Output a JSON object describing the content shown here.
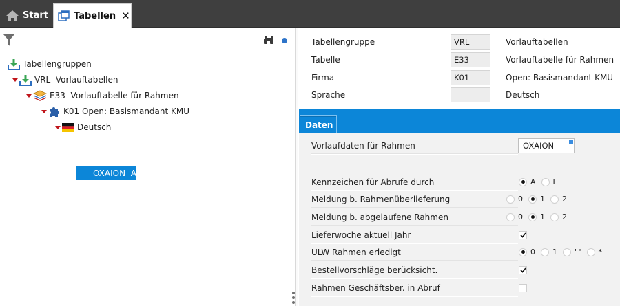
{
  "tabs": [
    {
      "label": "Start",
      "icon": "home-icon"
    },
    {
      "label": "Tabellen",
      "icon": "window-icon",
      "close": "✕"
    }
  ],
  "tree": {
    "toolbar": {
      "filter_icon": "filter-icon",
      "search_icon": "binoculars-icon",
      "status_icon": "status-dot-icon"
    },
    "nodes": [
      {
        "label": "Tabellengruppen",
        "icon": "download-icon"
      },
      {
        "label": "VRL  Vorlauftabellen",
        "icon": "download-icon"
      },
      {
        "label": "E33  Vorlauftabelle für Rahmen",
        "icon": "table-layers-icon"
      },
      {
        "label": "K01 Open: Basismandant KMU",
        "icon": "puzzle-icon"
      },
      {
        "label": "Deutsch",
        "icon": "german-flag-icon"
      }
    ],
    "selected": "OXAION  A"
  },
  "header_fields": [
    {
      "label": "Tabellengruppe",
      "code": "VRL",
      "desc": "Vorlauftabellen"
    },
    {
      "label": "Tabelle",
      "code": "E33",
      "desc": "Vorlauftabelle für Rahmen"
    },
    {
      "label": "Firma",
      "code": "K01",
      "desc": "Open: Basismandant KMU"
    },
    {
      "label": "Sprache",
      "code": "",
      "desc": "Deutsch"
    }
  ],
  "section_tab": "Daten",
  "form": {
    "vorlaufdaten_label": "Vorlaufdaten für Rahmen",
    "vorlaufdaten_value": "OXAION",
    "kennzeichen": {
      "label": "Kennzeichen für Abrufe durch",
      "options": [
        "A",
        "L"
      ],
      "selected": "A"
    },
    "meldung_ueber": {
      "label": "Meldung b. Rahmenüberlieferung",
      "options": [
        "0",
        "1",
        "2"
      ],
      "selected": "1"
    },
    "meldung_abgelaufen": {
      "label": "Meldung b. abgelaufene Rahmen",
      "options": [
        "0",
        "1",
        "2"
      ],
      "selected": "1"
    },
    "lieferwoche": {
      "label": "Lieferwoche aktuell Jahr",
      "checked": true
    },
    "ulw": {
      "label": "ULW Rahmen erledigt",
      "options": [
        "0",
        "1",
        "' '",
        "*"
      ],
      "selected": "0"
    },
    "bestell": {
      "label": "Bestellvorschläge berücksicht.",
      "checked": true
    },
    "rahmen_gb": {
      "label": "Rahmen Geschäftsber. in Abruf",
      "checked": false
    }
  },
  "colors": {
    "accent": "#0c86d8",
    "tabbar": "#3f3f3f",
    "tree_triangle": "#c0151b",
    "download_green": "#3aa655",
    "download_blue": "#2d6fc0"
  }
}
